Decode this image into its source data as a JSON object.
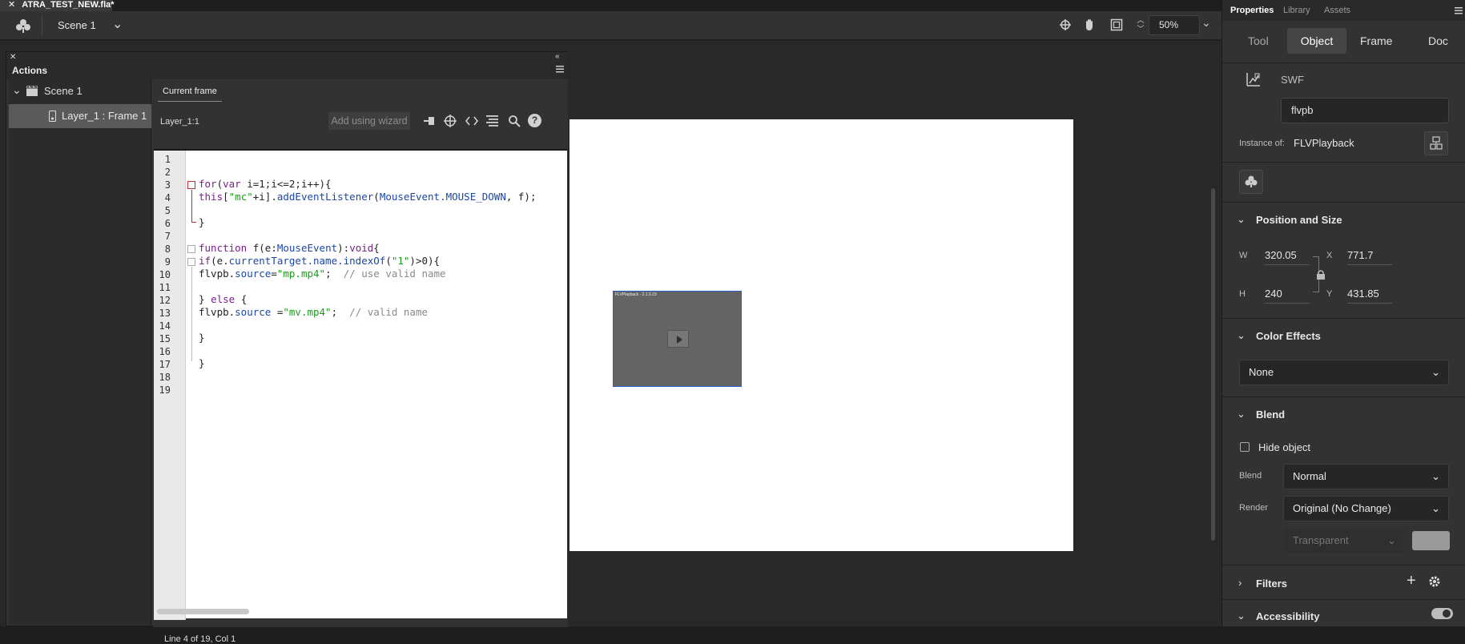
{
  "document": {
    "tab_title": "ATRA_TEST_NEW.fla*"
  },
  "toolbar": {
    "scene_name": "Scene 1",
    "zoom": "50%"
  },
  "actions_panel": {
    "title": "Actions",
    "tree": {
      "scene": "Scene 1",
      "layer_frame": "Layer_1 : Frame 1"
    },
    "tab": "Current frame",
    "layer_label": "Layer_1:1",
    "wizard_button": "Add using wizard",
    "status": "Line 4 of 19, Col 1",
    "line_numbers": [
      "1",
      "2",
      "3",
      "4",
      "5",
      "6",
      "7",
      "8",
      "9",
      "10",
      "11",
      "12",
      "13",
      "14",
      "15",
      "16",
      "17",
      "18",
      "19"
    ],
    "code": {
      "l3_kw": "for",
      "l3_a": "(",
      "l3_var": "var",
      "l3_b": " i=1;i<=2;i++){",
      "l4_this": "this",
      "l4_a": "[",
      "l4_str": "\"mc\"",
      "l4_b": "+i].",
      "l4_method": "addEventListener",
      "l4_c": "(",
      "l4_type": "MouseEvent.MOUSE_DOWN",
      "l4_d": ", f);",
      "l6": "}",
      "l8_kw": "function",
      "l8_a": " f(e:",
      "l8_type": "MouseEvent",
      "l8_b": "):",
      "l8_void": "void",
      "l8_c": "{",
      "l9_kw": "if",
      "l9_a": "(e.",
      "l9_prop": "currentTarget.name.indexOf",
      "l9_b": "(",
      "l9_str": "\"1\"",
      "l9_c": ")>0){",
      "l10_a": "flvpb.",
      "l10_prop": "source",
      "l10_b": "=",
      "l10_str": "\"mp.mp4\"",
      "l10_c": ";  ",
      "l10_com": "// use valid name",
      "l12_a": "} ",
      "l12_kw": "else",
      "l12_b": " {",
      "l13_a": "flvpb.",
      "l13_prop": "source",
      "l13_b": " =",
      "l13_str": "\"mv.mp4\"",
      "l13_c": ";  ",
      "l13_com": "// valid name",
      "l15": "}",
      "l17": "}"
    }
  },
  "stage": {
    "component_label": "FLVPlayback - 2.1.0.23"
  },
  "properties": {
    "tabs": [
      "Properties",
      "Library",
      "Assets"
    ],
    "subtabs": [
      "Tool",
      "Object",
      "Frame",
      "Doc"
    ],
    "symbol_type": "SWF",
    "instance_name": "flvpb",
    "instance_of_label": "Instance of:",
    "instance_of_value": "FLVPlayback",
    "position_size": {
      "title": "Position and Size",
      "w_label": "W",
      "w": "320.05",
      "h_label": "H",
      "h": "240",
      "x_label": "X",
      "x": "771.7",
      "y_label": "Y",
      "y": "431.85"
    },
    "color_effects": {
      "title": "Color Effects",
      "value": "None"
    },
    "blend": {
      "title": "Blend",
      "hide_object": "Hide object",
      "blend_label": "Blend",
      "blend_value": "Normal",
      "render_label": "Render",
      "render_value": "Original (No Change)",
      "bg_value": "Transparent"
    },
    "filters": {
      "title": "Filters"
    },
    "accessibility": {
      "title": "Accessibility"
    }
  },
  "colors": {
    "accent_blue": "#2563c9",
    "selected_row": "#5a5a5a",
    "active_subtab": "#454545"
  }
}
